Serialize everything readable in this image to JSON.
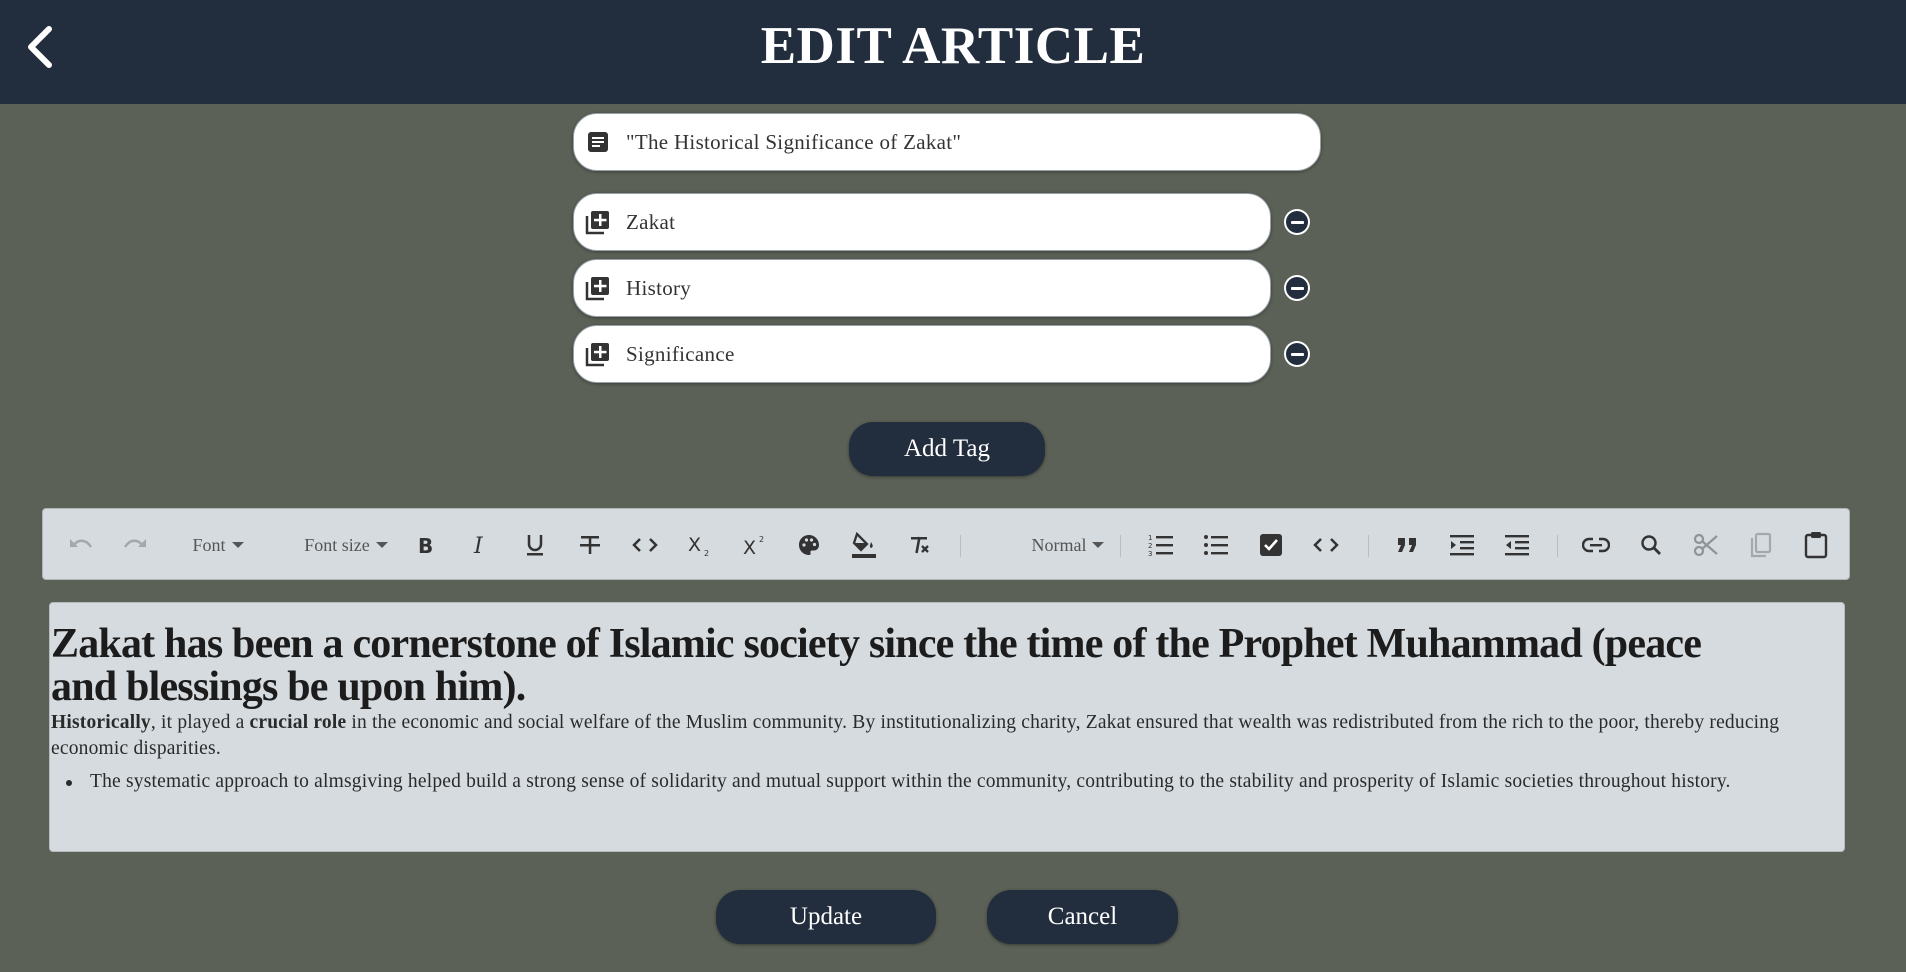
{
  "header": {
    "title": "EDIT ARTICLE",
    "back_icon": "chevron-left-icon"
  },
  "form": {
    "title_value": "\"The Historical Significance of Zakat\"",
    "tags": [
      {
        "value": "Zakat"
      },
      {
        "value": "History"
      },
      {
        "value": "Significance"
      }
    ],
    "add_tag_label": "Add Tag"
  },
  "toolbar": {
    "font_label": "Font",
    "font_size_label": "Font size",
    "block_label": "Normal",
    "icons": [
      "undo-icon",
      "redo-icon",
      "bold-icon",
      "italic-icon",
      "underline-icon",
      "strikethrough-icon",
      "code-icon",
      "subscript-icon",
      "superscript-icon",
      "palette-icon",
      "fill-color-icon",
      "clear-format-icon",
      "ordered-list-icon",
      "bullet-list-icon",
      "checklist-icon",
      "code-block-icon",
      "quote-icon",
      "indent-icon",
      "outdent-icon",
      "link-icon",
      "search-icon",
      "cut-icon",
      "copy-icon",
      "paste-icon"
    ]
  },
  "content": {
    "heading": "Zakat has been a cornerstone of Islamic society since the time of the Prophet Muhammad (peace and blessings be upon him).",
    "para_bold1": "Historically",
    "para_text1": ", it played a ",
    "para_bold2": "crucial role",
    "para_text2": " in the economic and social welfare of the Muslim community. By institutionalizing charity, Zakat ensured that wealth was redistributed from the rich to the poor, thereby reducing economic disparities.",
    "bullets": [
      "The systematic approach to almsgiving helped build a strong sense of solidarity and mutual support within the community, contributing to the stability and prosperity of Islamic societies throughout history."
    ]
  },
  "actions": {
    "update_label": "Update",
    "cancel_label": "Cancel"
  },
  "colors": {
    "header_bg": "#222d3d",
    "page_bg": "#5b6156",
    "editor_bg": "#d5dbdf"
  }
}
